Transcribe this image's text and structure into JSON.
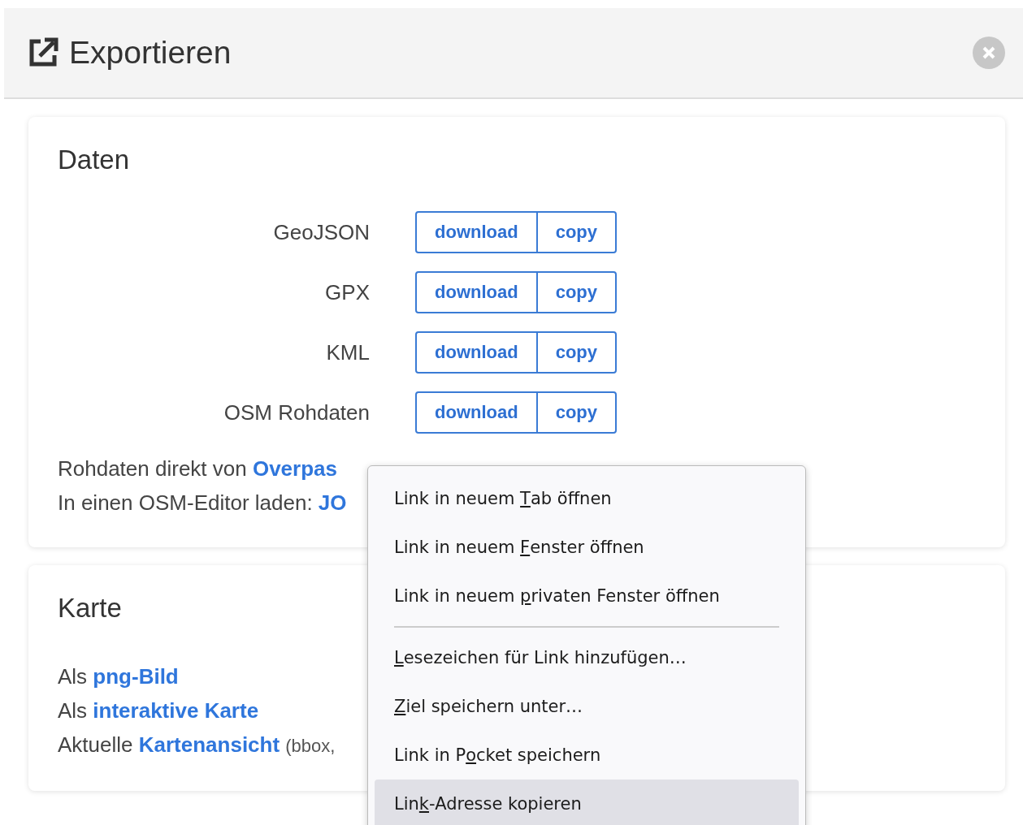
{
  "header": {
    "title": "Exportieren"
  },
  "data_card": {
    "heading": "Daten",
    "formats": [
      {
        "label": "GeoJSON",
        "buttons": [
          "download",
          "copy"
        ]
      },
      {
        "label": "GPX",
        "buttons": [
          "download",
          "copy"
        ]
      },
      {
        "label": "KML",
        "buttons": [
          "download",
          "copy"
        ]
      },
      {
        "label": "OSM Rohdaten",
        "buttons": [
          "download",
          "copy"
        ]
      }
    ],
    "lines": [
      {
        "text": "Rohdaten direkt von ",
        "link": "Overpas"
      },
      {
        "text": "In einen OSM-Editor laden: ",
        "link": "JO"
      }
    ]
  },
  "map_card": {
    "heading": "Karte",
    "lines": [
      {
        "text": "Als ",
        "link": "png-Bild"
      },
      {
        "text": "Als ",
        "link": "interaktive Karte"
      },
      {
        "text": "Aktuelle ",
        "link": "Kartenansicht",
        "note": "(bbox,"
      }
    ]
  },
  "context_menu": {
    "items": [
      {
        "kind": "item",
        "before": "Link in neuem ",
        "key": "T",
        "after": "ab öffnen",
        "selected": false
      },
      {
        "kind": "item",
        "before": "Link in neuem ",
        "key": "F",
        "after": "enster öffnen",
        "selected": false
      },
      {
        "kind": "item",
        "before": "Link in neuem ",
        "key": "p",
        "after": "rivaten Fenster öffnen",
        "selected": false
      },
      {
        "kind": "separator"
      },
      {
        "kind": "item",
        "key": "L",
        "after": "esezeichen für Link hinzufügen…",
        "selected": false
      },
      {
        "kind": "item",
        "key": "Z",
        "after": "iel speichern unter…",
        "selected": false
      },
      {
        "kind": "item",
        "before": "Link in P",
        "key": "o",
        "after": "cket speichern",
        "selected": false
      },
      {
        "kind": "item",
        "before": "Lin",
        "key": "k",
        "after": "-Adresse kopieren",
        "selected": true
      }
    ]
  }
}
